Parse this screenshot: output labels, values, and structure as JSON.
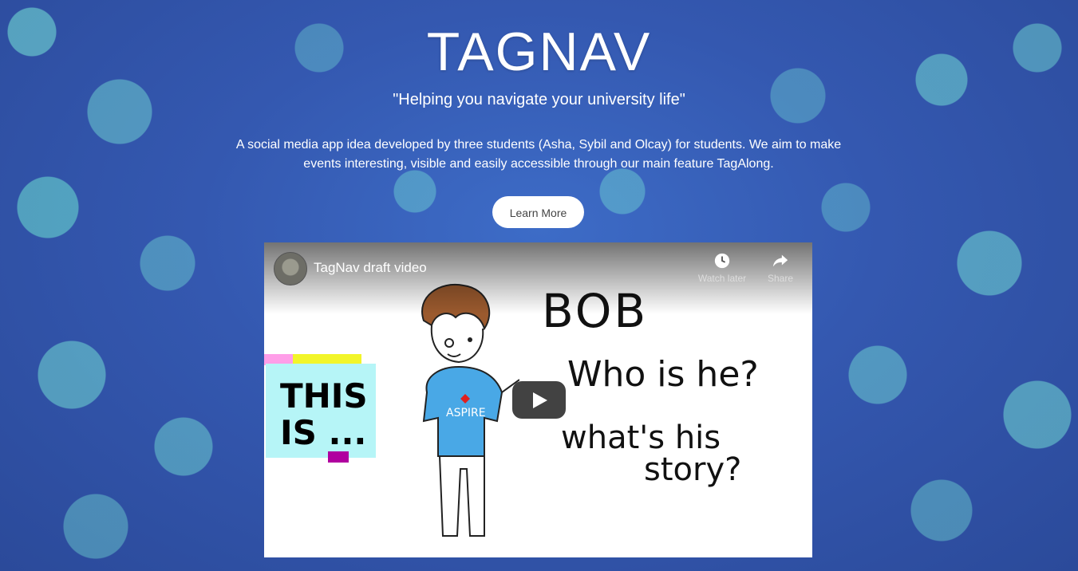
{
  "hero": {
    "title": "TAGNAV",
    "tagline": "\"Helping you navigate your university life\"",
    "description": "A social media app idea developed by three students (Asha, Sybil and Olcay) for students. We aim to make events interesting, visible and easily accessible through our main feature TagAlong.",
    "button_label": "Learn More"
  },
  "video": {
    "title": "TagNav draft video",
    "watch_later_label": "Watch later",
    "share_label": "Share",
    "thumbnail_text": {
      "sticky_note": "THIS\nIS ...",
      "name": "BOB",
      "line1": "Who is he?",
      "line2": "what's his",
      "line3": "story?",
      "shirt": "ASPIRE"
    }
  }
}
